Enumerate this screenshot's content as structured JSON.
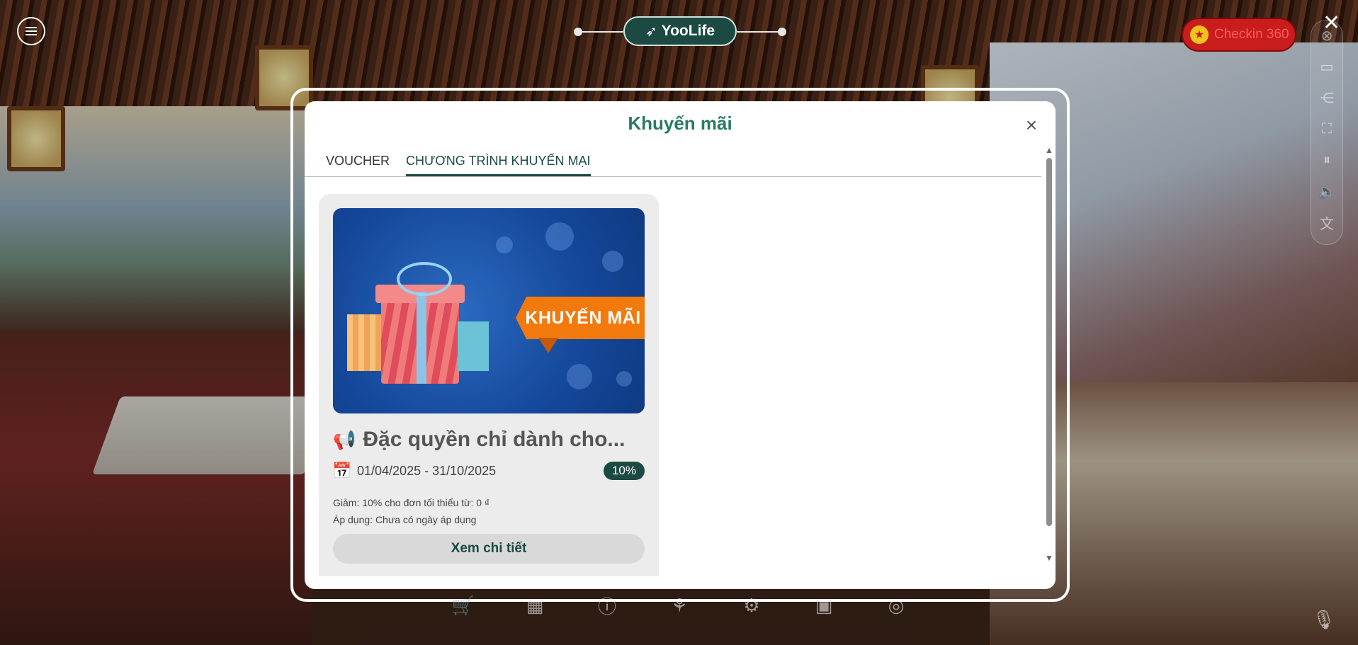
{
  "app": {
    "logo_text": "YooLife",
    "checkin_label": "Checkin 360"
  },
  "top_chrome": {
    "close_symbol": "✕"
  },
  "side_tools": [
    {
      "icon": "vr-headset-icon"
    },
    {
      "icon": "share-icon"
    },
    {
      "icon": "fullscreen-icon"
    },
    {
      "icon": "pause-icon"
    },
    {
      "icon": "volume-icon"
    },
    {
      "icon": "translate-icon"
    }
  ],
  "modal": {
    "title": "Khuyến mãi",
    "close_symbol": "×",
    "tabs": [
      {
        "label": "VOUCHER",
        "active": false
      },
      {
        "label": "CHƯƠNG TRÌNH KHUYẾN MẠI",
        "active": true
      }
    ]
  },
  "promo_card": {
    "banner_text": "KHUYẾN MÃI",
    "title": "Đặc quyền chỉ dành cho...",
    "title_icon": "megaphone-icon",
    "date_range": "01/04/2025 - 31/10/2025",
    "discount_badge": "10%",
    "discount_line": "Giảm: 10% cho đơn tối thiểu từ: 0 ₫",
    "apply_line": "Áp dụng: Chưa có ngày áp dụng",
    "detail_button": "Xem chi tiết"
  },
  "bottom_tools": [
    {
      "icon": "cart-icon"
    },
    {
      "icon": "grid-icon"
    },
    {
      "icon": "info-icon"
    },
    {
      "icon": "rocket-icon"
    },
    {
      "icon": "settings-icon"
    },
    {
      "icon": "gallery-icon"
    },
    {
      "icon": "camera-360-icon"
    }
  ],
  "colors": {
    "accent": "#1c4a42",
    "title_green": "#2a7a63",
    "checkin_red": "#c91d1d",
    "promo_orange": "#f27a0d"
  }
}
